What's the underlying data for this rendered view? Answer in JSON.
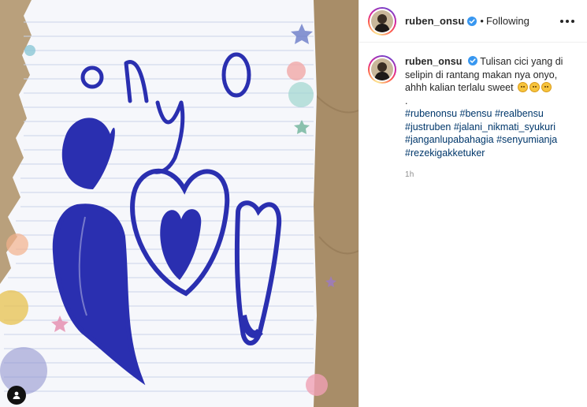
{
  "post": {
    "author": "ruben_onsu",
    "follow_separator": "•",
    "follow_status": "Following",
    "caption_line1": "Tulisan cici yang di selipin di rantang makan nya onyo, ahhh kalian terlalu sweet",
    "caption_dot": ".",
    "hashtags_line1": "#rubenonsu #bensu #realbensu",
    "hashtags_line2": "#justruben #jalani_nikmati_syukuri",
    "hashtags_line3": "#janganlupabahagia #senyumianja",
    "hashtags_line4": "#rezekigakketuker",
    "time_ago": "1h"
  },
  "photo": {
    "handwriting": "onyo",
    "ink_color": "#2a2fb0",
    "paper_color": "#f6f7fb",
    "table_color": "#b9a07c"
  },
  "icons": {
    "verified": "verified-badge-icon",
    "more": "more-options-icon",
    "user_tag": "user-tag-icon",
    "emoji": "smiling-face-emoji-icon"
  },
  "colors": {
    "text": "#262626",
    "hashtag": "#00376b",
    "muted": "#8e8e8e",
    "verified": "#3897f0"
  }
}
